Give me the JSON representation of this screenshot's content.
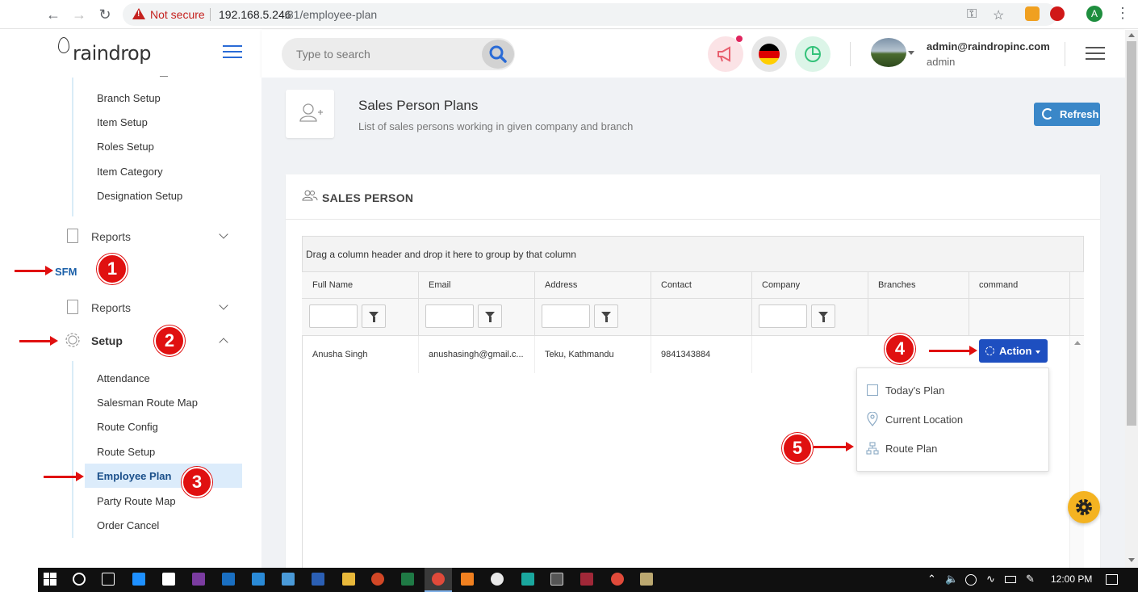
{
  "browser": {
    "not_secure": "Not secure",
    "url_host": "192.168.5.246",
    "url_rest": ":81/employee-plan",
    "profile_initial": "A"
  },
  "app": {
    "logo": "raindrop",
    "search_placeholder": "Type to search",
    "user_email": "admin@raindropinc.com",
    "user_role": "admin"
  },
  "sidebar": {
    "setup_items_top": [
      "Branch Setup",
      "Item Setup",
      "Roles Setup",
      "Item Category",
      "Designation Setup"
    ],
    "reports_label": "Reports",
    "sfm_label": "SFM",
    "reports2_label": "Reports",
    "setup_label": "Setup",
    "sfm_items": [
      "Attendance",
      "Salesman Route Map",
      "Route Config",
      "Route Setup",
      "Employee Plan",
      "Party Route Map",
      "Order Cancel"
    ]
  },
  "annotations": {
    "badge_1": "1",
    "badge_2": "2",
    "badge_3": "3",
    "badge_4": "4",
    "badge_5": "5"
  },
  "page": {
    "title": "Sales Person Plans",
    "subtitle": "List of sales persons working in given company and branch",
    "refresh_label": "Refresh"
  },
  "panel": {
    "title": "SALES PERSON",
    "group_hint": "Drag a column header and drop it here to group by that column",
    "columns": [
      "Full Name",
      "Email",
      "Address",
      "Contact",
      "Company",
      "Branches",
      "command"
    ],
    "rows": [
      {
        "full_name": "Anusha Singh",
        "email": "anushasingh@gmail.c...",
        "address": "Teku, Kathmandu",
        "contact": "9841343884",
        "company": "",
        "branches": ""
      }
    ],
    "action_label": "Action",
    "action_menu": [
      "Today's Plan",
      "Current Location",
      "Route Plan"
    ]
  },
  "taskbar": {
    "clock": "12:00 PM"
  },
  "colors": {
    "primary": "#1e4fc0",
    "refresh": "#3a87c8",
    "annotation_red": "#e01010",
    "fab": "#f4b321",
    "active_bg": "#dcecfb",
    "sfm_text": "#1a5fa8"
  }
}
